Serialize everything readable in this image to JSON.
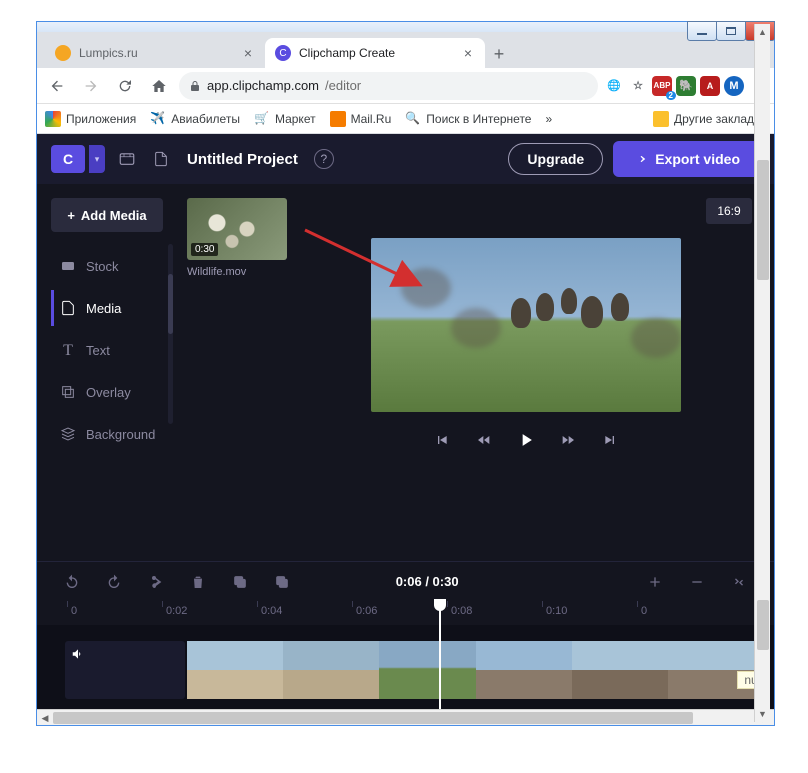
{
  "window": {
    "min": "",
    "max": "",
    "close": ""
  },
  "tabs": [
    {
      "title": "Lumpics.ru",
      "favicon_color": "#f5a623"
    },
    {
      "title": "Clipchamp Create",
      "favicon_color": "#5a4ce0"
    }
  ],
  "newtab_label": "+",
  "address": {
    "lock": "lock-icon",
    "host": "app.clipchamp.com",
    "path": "/editor"
  },
  "extensions": {
    "translate": "translate-icon",
    "star": "star-icon",
    "adblock": "ABP",
    "adblock_badge": "2",
    "evernote": "evernote-icon",
    "pdf": "pdf-icon",
    "profile": "M",
    "menu": "menu-icon"
  },
  "bookmarks": {
    "apps": "Приложения",
    "avia": "Авиабилеты",
    "market": "Маркет",
    "mail": "Mail.Ru",
    "search": "Поиск в Интернете",
    "more": "»",
    "other": "Другие закладки"
  },
  "app_top": {
    "logo": "C",
    "project_title": "Untitled Project",
    "help": "?",
    "upgrade": "Upgrade",
    "export": "Export video"
  },
  "sidebar": {
    "add_media": "Add Media",
    "items": [
      {
        "label": "Stock"
      },
      {
        "label": "Media"
      },
      {
        "label": "Text"
      },
      {
        "label": "Overlay"
      },
      {
        "label": "Background"
      }
    ]
  },
  "media": {
    "clip_duration": "0:30",
    "clip_name": "Wildlife.mov"
  },
  "stage": {
    "aspect": "16:9"
  },
  "timeline": {
    "time": "0:06 / 0:30",
    "ticks": [
      "0",
      "0:02",
      "0:04",
      "0:06",
      "0:08",
      "0:10",
      "0"
    ]
  },
  "status": {
    "null": "null"
  }
}
